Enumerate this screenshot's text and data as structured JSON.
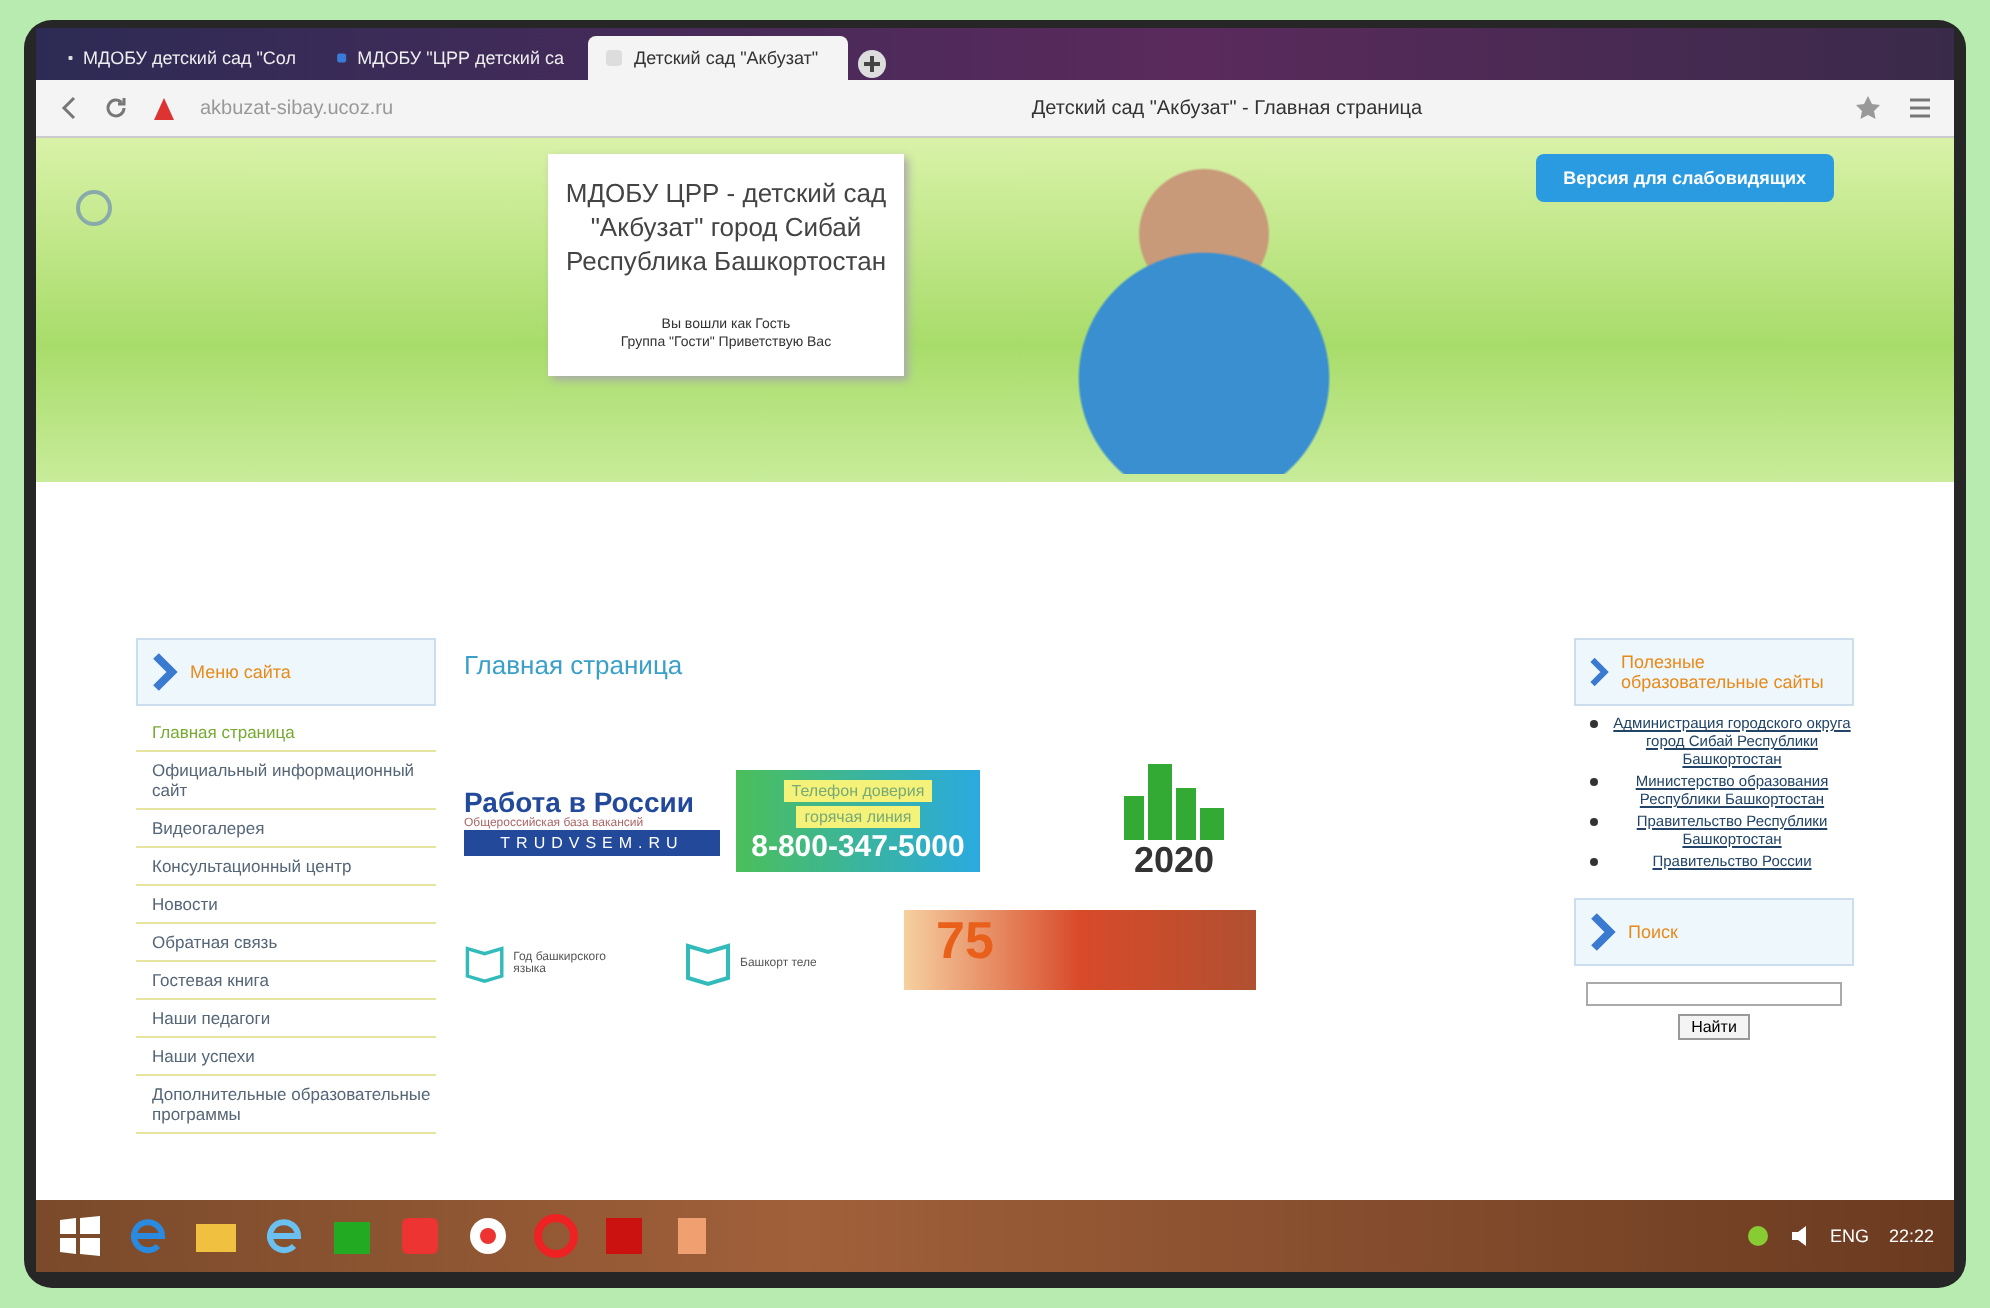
{
  "tabs": [
    {
      "label": "МДОБУ детский сад \"Сол",
      "selected": false
    },
    {
      "label": "МДОБУ \"ЦРР детский са",
      "selected": false
    },
    {
      "label": "Детский сад \"Акбузат\"",
      "selected": true
    }
  ],
  "address": "akbuzat-sibay.ucoz.ru",
  "page_title": "Детский сад \"Акбузат\" - Главная страница",
  "header": {
    "site_name": "МДОБУ ЦРР - детский сад \"Акбузат\" город Сибай Республика Башкортостан",
    "login_note": "Вы вошли как Гость",
    "group_note": "Группа \"Гости\" Приветствую Вас",
    "accessibility_button": "Версия для слабовидящих"
  },
  "left_menu": {
    "title": "Меню сайта",
    "items": [
      {
        "label": "Главная страница",
        "selected": true
      },
      {
        "label": "Официальный информационный сайт",
        "selected": false
      },
      {
        "label": "Видеогалерея",
        "selected": false
      },
      {
        "label": "Консультационный центр",
        "selected": false
      },
      {
        "label": "Новости",
        "selected": false
      },
      {
        "label": "Обратная связь",
        "selected": false
      },
      {
        "label": "Гостевая книга",
        "selected": false
      },
      {
        "label": "Наши педагоги",
        "selected": false
      },
      {
        "label": "Наши успехи",
        "selected": false
      },
      {
        "label": "Дополнительные образовательные программы",
        "selected": false
      }
    ]
  },
  "main": {
    "heading": "Главная страница",
    "trudvsem": {
      "title": "Работа в России",
      "subtitle": "Общероссийская база вакансий",
      "url": "TRUDVSEM.RU"
    },
    "hotline": {
      "line1": "Телефон доверия",
      "line2": "горячая линия",
      "phone": "8-800-347-5000"
    },
    "year_badge": "2020",
    "book_logos": [
      "Год башкирского языка",
      "Башкорт теле"
    ],
    "anniversary": "75"
  },
  "right": {
    "links_title": "Полезные образовательные сайты",
    "links": [
      "Администрация городского округа город Сибай Республики Башкортостан",
      "Министерство образования Республики Башкортостан",
      "Правительство Республики Башкортостан",
      "Правительство России"
    ],
    "search_title": "Поиск",
    "search_button": "Найти"
  },
  "taskbar": {
    "language": "ENG",
    "time": "22:22"
  }
}
